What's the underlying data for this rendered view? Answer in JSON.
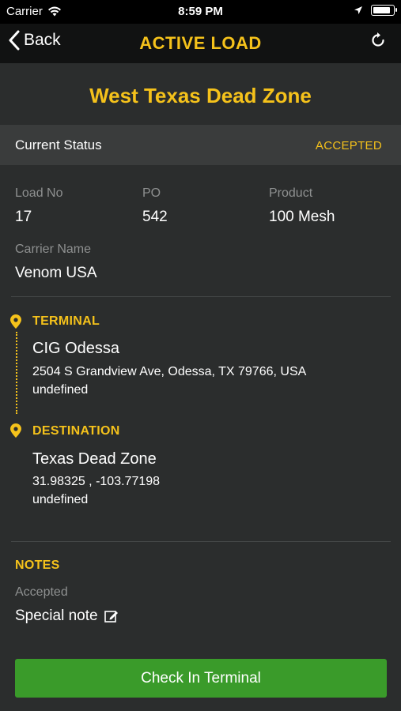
{
  "status_bar": {
    "carrier": "Carrier",
    "time": "8:59 PM",
    "battery_level": 0.9
  },
  "nav": {
    "back_label": "Back",
    "title": "ACTIVE LOAD",
    "refresh_icon": "refresh-icon"
  },
  "load": {
    "title": "West Texas Dead Zone",
    "status_label": "Current Status",
    "status_value": "ACCEPTED",
    "fields": {
      "load_no_label": "Load No",
      "load_no": "17",
      "po_label": "PO",
      "po": "542",
      "product_label": "Product",
      "product": "100 Mesh",
      "carrier_label": "Carrier Name",
      "carrier": "Venom USA"
    }
  },
  "terminal": {
    "heading": "TERMINAL",
    "name": "CIG Odessa",
    "address": "2504 S Grandview Ave, Odessa, TX 79766, USA",
    "extra": "undefined"
  },
  "destination": {
    "heading": "DESTINATION",
    "name": "Texas Dead Zone",
    "coords": "31.98325 , -103.77198",
    "extra": "undefined"
  },
  "notes": {
    "heading": "NOTES",
    "label": "Accepted",
    "value": "Special note",
    "edit_icon": "edit-icon"
  },
  "action": {
    "label": "Check In Terminal"
  },
  "colors": {
    "accent": "#f5c21b",
    "button": "#3a9b2a",
    "background": "#2b2d2d"
  }
}
